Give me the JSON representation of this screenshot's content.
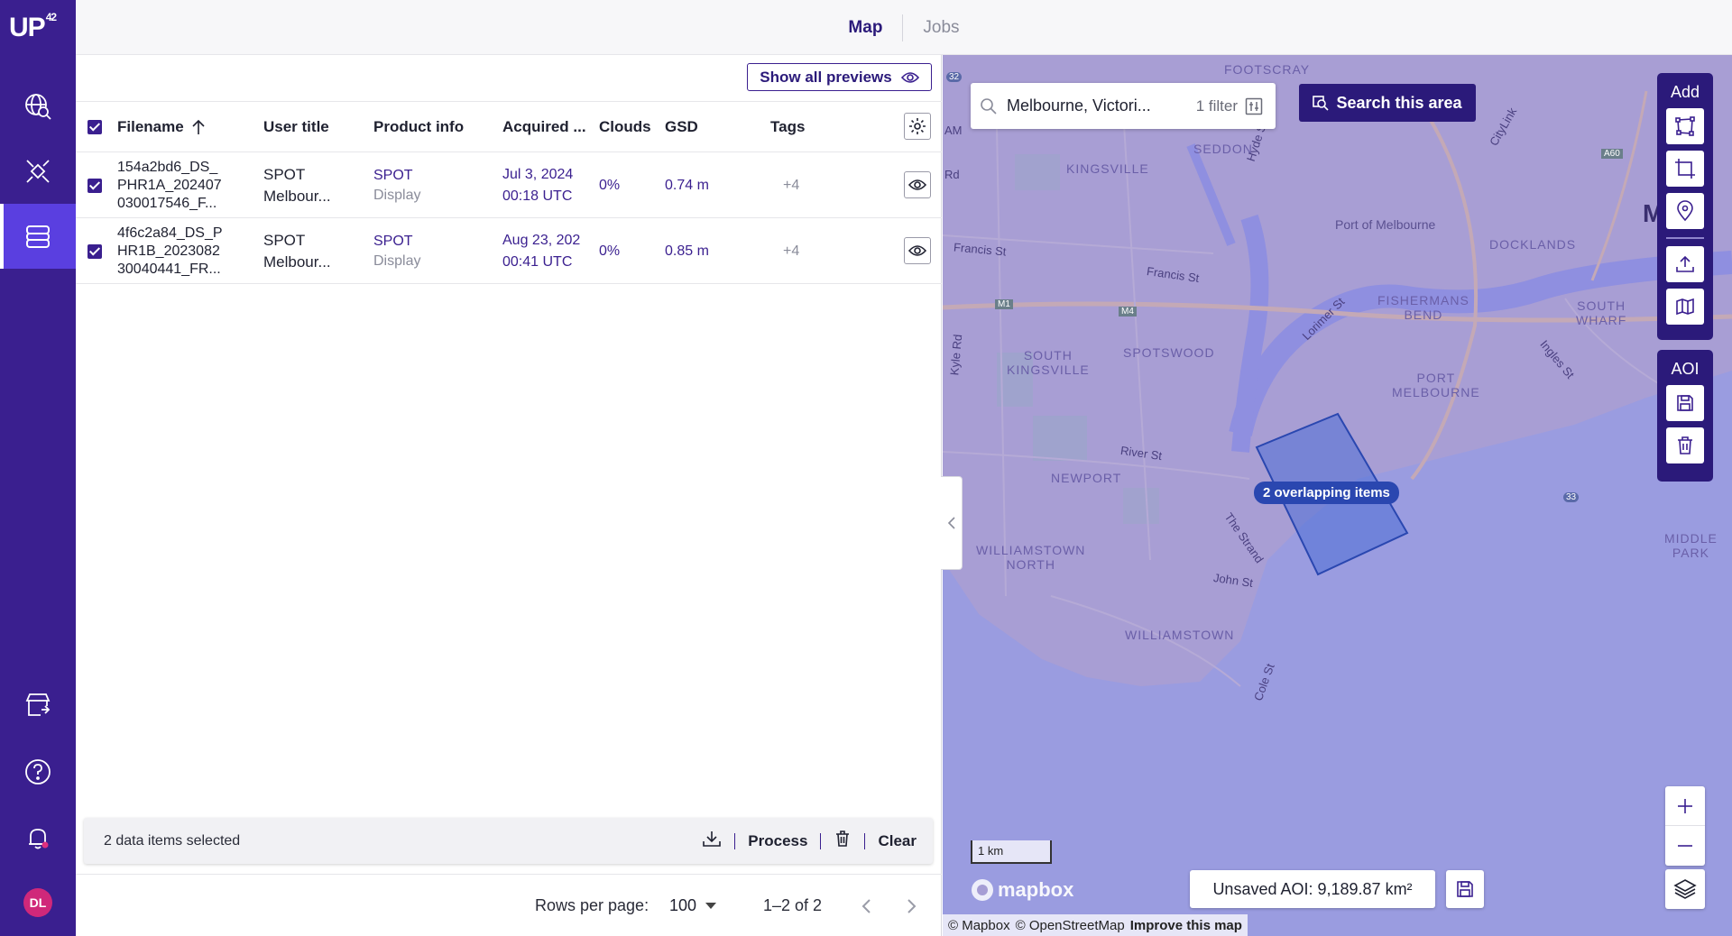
{
  "app": {
    "logo_text": "UP",
    "logo_sup": "42",
    "avatar_initials": "DL",
    "brand_color": "#3a1f8f",
    "accent_color": "#5a3fe0"
  },
  "sidebar": {
    "items": [
      {
        "icon": "globe-search-icon"
      },
      {
        "icon": "satellite-icon"
      },
      {
        "icon": "storage-icon",
        "active": true
      },
      {
        "icon": "marketplace-icon"
      },
      {
        "icon": "help-icon"
      },
      {
        "icon": "bell-icon"
      }
    ]
  },
  "topbar": {
    "tabs": [
      {
        "label": "Map",
        "active": true
      },
      {
        "label": "Jobs",
        "active": false
      }
    ]
  },
  "table": {
    "show_previews_label": "Show all previews",
    "columns": [
      "Filename",
      "User title",
      "Product info",
      "Acquired ...",
      "Clouds",
      "GSD",
      "Tags"
    ],
    "rows": [
      {
        "filename": [
          "154a2bd6_DS_",
          "PHR1A_202407",
          "030017546_F..."
        ],
        "user_title": [
          "SPOT",
          "Melbour..."
        ],
        "product_info": [
          "SPOT",
          "Display"
        ],
        "acquired": [
          "Jul 3, 2024",
          "00:18 UTC"
        ],
        "clouds": "0%",
        "gsd": "0.74 m",
        "tags": "+4"
      },
      {
        "filename": [
          "4f6c2a84_DS_P",
          "HR1B_2023082",
          "30040441_FR..."
        ],
        "user_title": [
          "SPOT",
          "Melbour..."
        ],
        "product_info": [
          "SPOT",
          "Display"
        ],
        "acquired": [
          "Aug 23, 202",
          "00:41 UTC"
        ],
        "clouds": "0%",
        "gsd": "0.85 m",
        "tags": "+4"
      }
    ]
  },
  "selection_bar": {
    "text": "2 data items selected",
    "process_label": "Process",
    "clear_label": "Clear"
  },
  "pagination": {
    "rows_per_page_label": "Rows per page:",
    "rows_per_page_value": "100",
    "range": "1–2 of 2"
  },
  "map": {
    "search_value": "Melbourne, Victori...",
    "filter_label": "1 filter",
    "search_area_label": "Search this area",
    "add_group_title": "Add",
    "aoi_group_title": "AOI",
    "overlap_label": "2 overlapping items",
    "aoi_info": "Unsaved AOI: 9,189.87 km²",
    "scale_label": "1 km",
    "mapbox_label": "mapbox",
    "attribution": [
      "© Mapbox",
      "© OpenStreetMap",
      "Improve this map"
    ],
    "place_labels": {
      "footscray": "FOOTSCRAY",
      "seddon": "SEDDON",
      "kingsville": "KINGSVILLE",
      "port_of_melbourne": "Port of Melbourne",
      "docklands": "DOCKLANDS",
      "fishermans_bend": "FISHERMANS\nBEND",
      "south_wharf": "SOUTH\nWHARF",
      "south_kingsville": "SOUTH\nKINGSVILLE",
      "spotswood": "SPOTSWOOD",
      "port_melbourne": "PORT\nMELBOURNE",
      "newport": "NEWPORT",
      "williamstown_north": "WILLIAMSTOWN\nNORTH",
      "williamstown": "WILLIAMSTOWN",
      "middle_park": "MIDDLE\nPARK",
      "melbourne_partial": "Mu"
    },
    "street_labels": {
      "francis_st_1": "Francis St",
      "francis_st_2": "Francis St",
      "lorimer_st": "Lorimer St",
      "river_st": "River St",
      "the_strand": "The Strand",
      "john_st": "John St",
      "cole_st": "Cole St",
      "ingles_st": "Ingles St",
      "hyde_st": "Hyde St",
      "kyle_rd": "Kyle Rd",
      "citylink": "CityLink",
      "rd": "Rd",
      "am": "AM",
      "m1": "M1",
      "m4": "M4",
      "a60": "A60",
      "r32": "32",
      "r33": "33"
    },
    "water_color": "#9a9ce0",
    "land_color": "#a89ed4",
    "aoi_fill": "#4e6fd6"
  }
}
